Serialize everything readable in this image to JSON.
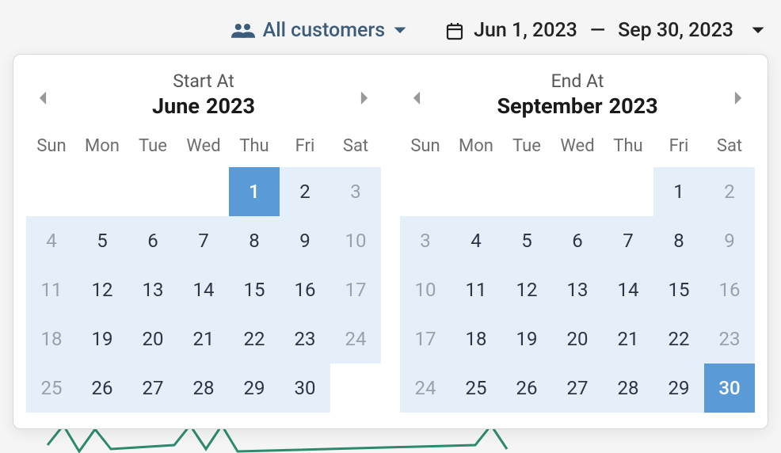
{
  "filters": {
    "customers_label": "All customers"
  },
  "date_range": {
    "start_display": "Jun 1, 2023",
    "end_display": "Sep 30, 2023"
  },
  "picker": {
    "start": {
      "label": "Start At",
      "month": "June",
      "year": "2023",
      "dow": [
        "Sun",
        "Mon",
        "Tue",
        "Wed",
        "Thu",
        "Fri",
        "Sat"
      ],
      "cells": [
        {
          "d": "",
          "cls": "empty"
        },
        {
          "d": "",
          "cls": "empty"
        },
        {
          "d": "",
          "cls": "empty"
        },
        {
          "d": "",
          "cls": "empty"
        },
        {
          "d": "1",
          "cls": "selected"
        },
        {
          "d": "2",
          "cls": "in-range"
        },
        {
          "d": "3",
          "cls": "in-range muted"
        },
        {
          "d": "4",
          "cls": "in-range muted"
        },
        {
          "d": "5",
          "cls": "in-range"
        },
        {
          "d": "6",
          "cls": "in-range"
        },
        {
          "d": "7",
          "cls": "in-range"
        },
        {
          "d": "8",
          "cls": "in-range"
        },
        {
          "d": "9",
          "cls": "in-range"
        },
        {
          "d": "10",
          "cls": "in-range muted"
        },
        {
          "d": "11",
          "cls": "in-range muted"
        },
        {
          "d": "12",
          "cls": "in-range"
        },
        {
          "d": "13",
          "cls": "in-range"
        },
        {
          "d": "14",
          "cls": "in-range"
        },
        {
          "d": "15",
          "cls": "in-range"
        },
        {
          "d": "16",
          "cls": "in-range"
        },
        {
          "d": "17",
          "cls": "in-range muted"
        },
        {
          "d": "18",
          "cls": "in-range muted"
        },
        {
          "d": "19",
          "cls": "in-range"
        },
        {
          "d": "20",
          "cls": "in-range"
        },
        {
          "d": "21",
          "cls": "in-range"
        },
        {
          "d": "22",
          "cls": "in-range"
        },
        {
          "d": "23",
          "cls": "in-range"
        },
        {
          "d": "24",
          "cls": "in-range muted"
        },
        {
          "d": "25",
          "cls": "in-range muted"
        },
        {
          "d": "26",
          "cls": "in-range"
        },
        {
          "d": "27",
          "cls": "in-range"
        },
        {
          "d": "28",
          "cls": "in-range"
        },
        {
          "d": "29",
          "cls": "in-range"
        },
        {
          "d": "30",
          "cls": "in-range"
        },
        {
          "d": "",
          "cls": "empty"
        }
      ]
    },
    "end": {
      "label": "End At",
      "month": "September",
      "year": "2023",
      "dow": [
        "Sun",
        "Mon",
        "Tue",
        "Wed",
        "Thu",
        "Fri",
        "Sat"
      ],
      "cells": [
        {
          "d": "",
          "cls": "empty"
        },
        {
          "d": "",
          "cls": "empty"
        },
        {
          "d": "",
          "cls": "empty"
        },
        {
          "d": "",
          "cls": "empty"
        },
        {
          "d": "",
          "cls": "empty"
        },
        {
          "d": "1",
          "cls": "in-range"
        },
        {
          "d": "2",
          "cls": "in-range muted"
        },
        {
          "d": "3",
          "cls": "in-range muted"
        },
        {
          "d": "4",
          "cls": "in-range"
        },
        {
          "d": "5",
          "cls": "in-range"
        },
        {
          "d": "6",
          "cls": "in-range"
        },
        {
          "d": "7",
          "cls": "in-range"
        },
        {
          "d": "8",
          "cls": "in-range"
        },
        {
          "d": "9",
          "cls": "in-range muted"
        },
        {
          "d": "10",
          "cls": "in-range muted"
        },
        {
          "d": "11",
          "cls": "in-range"
        },
        {
          "d": "12",
          "cls": "in-range"
        },
        {
          "d": "13",
          "cls": "in-range"
        },
        {
          "d": "14",
          "cls": "in-range"
        },
        {
          "d": "15",
          "cls": "in-range"
        },
        {
          "d": "16",
          "cls": "in-range muted"
        },
        {
          "d": "17",
          "cls": "in-range muted"
        },
        {
          "d": "18",
          "cls": "in-range"
        },
        {
          "d": "19",
          "cls": "in-range"
        },
        {
          "d": "20",
          "cls": "in-range"
        },
        {
          "d": "21",
          "cls": "in-range"
        },
        {
          "d": "22",
          "cls": "in-range"
        },
        {
          "d": "23",
          "cls": "in-range muted"
        },
        {
          "d": "24",
          "cls": "in-range muted"
        },
        {
          "d": "25",
          "cls": "in-range"
        },
        {
          "d": "26",
          "cls": "in-range"
        },
        {
          "d": "27",
          "cls": "in-range"
        },
        {
          "d": "28",
          "cls": "in-range"
        },
        {
          "d": "29",
          "cls": "in-range"
        },
        {
          "d": "30",
          "cls": "selected"
        }
      ]
    }
  }
}
